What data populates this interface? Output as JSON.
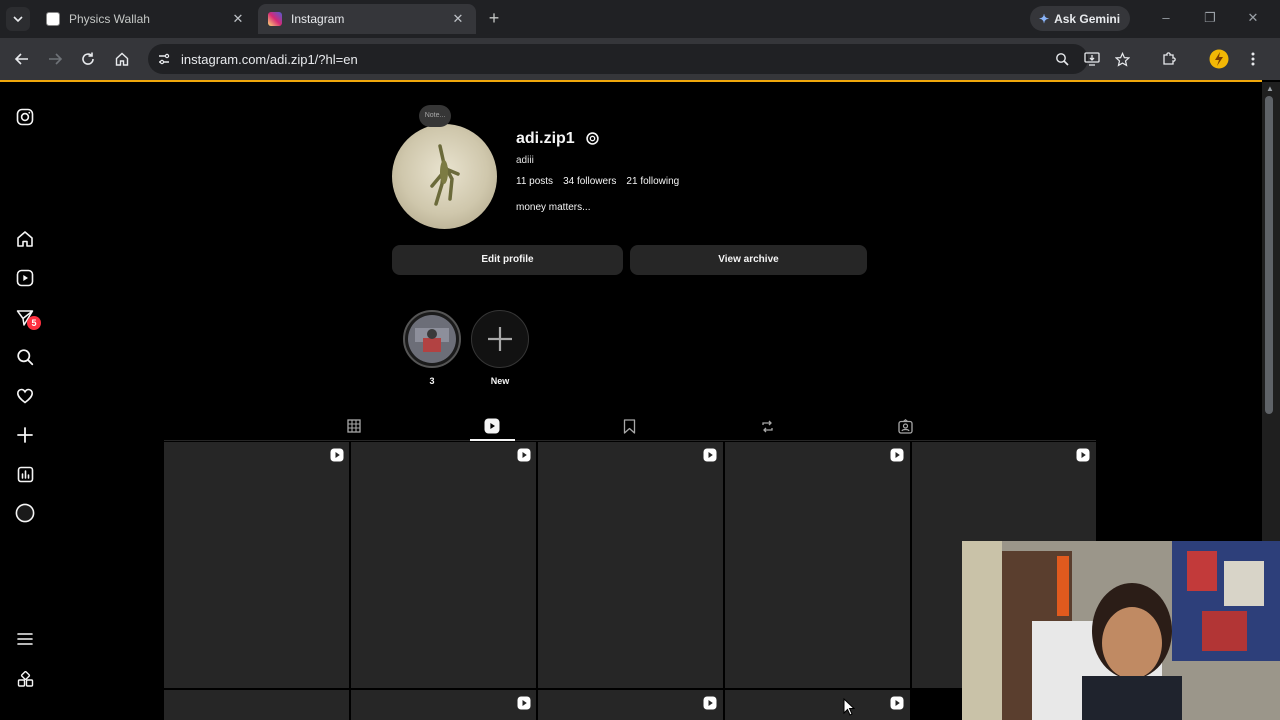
{
  "browser": {
    "tabs": [
      {
        "title": "Physics Wallah",
        "close": "✕"
      },
      {
        "title": "Instagram",
        "close": "✕"
      }
    ],
    "new_tab": "+",
    "gemini_label": "Ask Gemini",
    "url": "instagram.com/adi.zip1/?hl=en",
    "window_controls": [
      "–",
      "❐",
      "✕"
    ]
  },
  "sidebar": {
    "icons": [
      "instagram-logo-icon",
      "home-icon",
      "reels-icon",
      "messages-icon",
      "search-icon",
      "notifications-heart-icon",
      "create-plus-icon",
      "dashboard-icon",
      "profile-icon",
      "more-menu-icon",
      "also-from-meta-icon"
    ],
    "messages_badge": "5"
  },
  "profile": {
    "note": "Note...",
    "username": "adi.zip1",
    "full_name": "adiii",
    "stats": {
      "posts": "11 posts",
      "followers": "34 followers",
      "following": "21 following"
    },
    "bio": "money matters...",
    "edit_profile": "Edit profile",
    "view_archive": "View archive"
  },
  "highlights": [
    {
      "label": "3"
    },
    {
      "label": "New"
    }
  ],
  "profile_tabs": [
    "posts-grid-icon",
    "reels-tab-icon",
    "saved-icon",
    "reposts-icon",
    "tagged-icon"
  ],
  "active_tab": "reels",
  "colors": {
    "accent_load": "#f0a80c",
    "badge": "#ff3040",
    "background": "#000000",
    "surface": "#262626"
  }
}
